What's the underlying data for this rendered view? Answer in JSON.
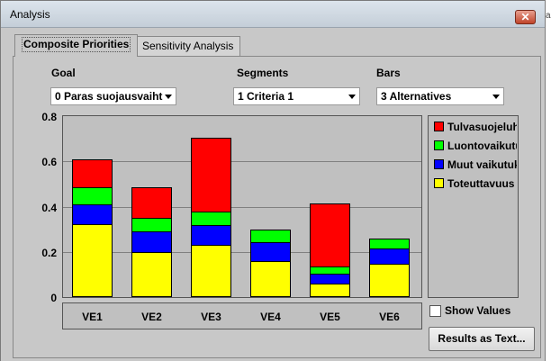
{
  "window": {
    "title": "Analysis",
    "close_glyph": "✕",
    "edge_glyph": "a"
  },
  "tabs": [
    {
      "label": "Composite Priorities",
      "active": true
    },
    {
      "label": "Sensitivity Analysis",
      "active": false
    }
  ],
  "controls": {
    "goal": {
      "label": "Goal",
      "value": "0 Paras suojausvaiht"
    },
    "segments": {
      "label": "Segments",
      "value": "1 Criteria 1"
    },
    "bars": {
      "label": "Bars",
      "value": "3 Alternatives"
    }
  },
  "chart_data": {
    "type": "bar",
    "stacked": true,
    "categories": [
      "VE1",
      "VE2",
      "VE3",
      "VE4",
      "VE5",
      "VE6"
    ],
    "ylim": [
      0,
      0.8
    ],
    "yticks": [
      "0",
      "0.2",
      "0.4",
      "0.6",
      "0.8"
    ],
    "grid": true,
    "legend_placement": "right",
    "series": [
      {
        "name": "Toteuttavuus",
        "color": "#ffff00",
        "values": [
          0.32,
          0.195,
          0.225,
          0.155,
          0.055,
          0.145
        ]
      },
      {
        "name": "Muut vaikutuk",
        "color": "#0000ff",
        "values": [
          0.085,
          0.09,
          0.09,
          0.085,
          0.045,
          0.065
        ]
      },
      {
        "name": "Luontovaikutu",
        "color": "#00ff00",
        "values": [
          0.075,
          0.06,
          0.06,
          0.055,
          0.03,
          0.045
        ]
      },
      {
        "name": "Tulvasuojeluh",
        "color": "#ff0000",
        "values": [
          0.125,
          0.135,
          0.325,
          0,
          0.28,
          0
        ]
      }
    ]
  },
  "legend_order": [
    "Tulvasuojeluh",
    "Luontovaikutu",
    "Muut vaikutuk",
    "Toteuttavuus"
  ],
  "options": {
    "show_values_label": "Show Values",
    "show_values_checked": false
  },
  "actions": {
    "results_label": "Results as Text..."
  }
}
